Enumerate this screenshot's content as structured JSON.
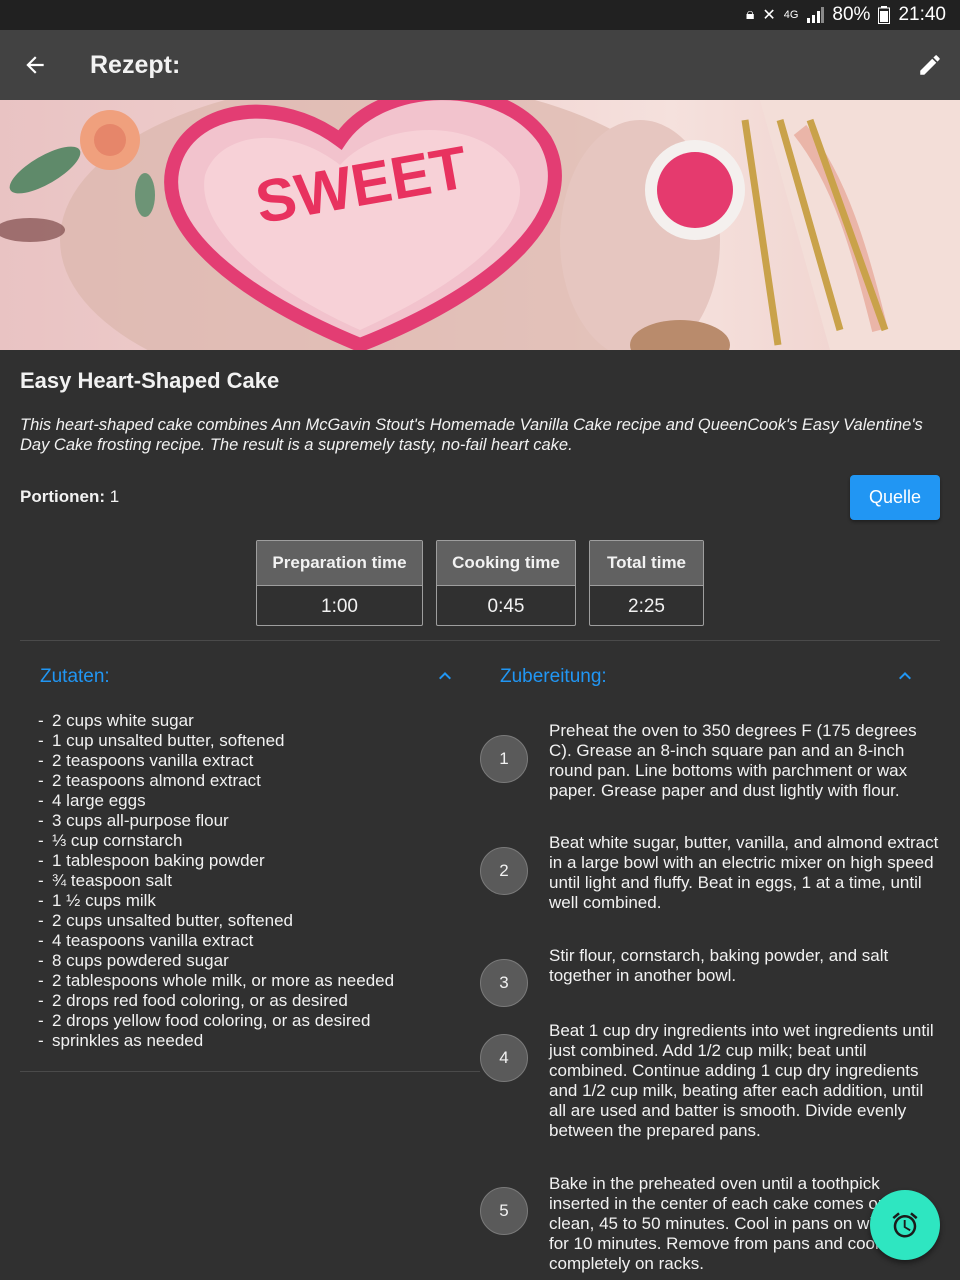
{
  "status_bar": {
    "battery": "80%",
    "time": "21:40",
    "network": "4G"
  },
  "app_bar": {
    "title": "Rezept:",
    "back_icon": "arrow-back-icon",
    "edit_icon": "pencil-icon"
  },
  "hero_image": {
    "text": "SWEET"
  },
  "recipe": {
    "title": "Easy Heart-Shaped Cake",
    "description": "This heart-shaped cake combines Ann McGavin Stout's Homemade Vanilla Cake recipe and QueenCook's Easy Valentine's Day Cake frosting recipe. The result is a supremely tasty, no-fail heart cake.",
    "servings_label": "Portionen:",
    "servings_value": "1",
    "source_button": "Quelle"
  },
  "times": [
    {
      "label": "Preparation time",
      "value": "1:00"
    },
    {
      "label": "Cooking time",
      "value": "0:45"
    },
    {
      "label": "Total time",
      "value": "2:25"
    }
  ],
  "ingredients_section": {
    "title": "Zutaten:",
    "items": [
      "2 cups white sugar",
      "1 cup unsalted butter, softened",
      "2 teaspoons vanilla extract",
      "2 teaspoons almond extract",
      "4 large eggs",
      "3 cups all-purpose flour",
      "⅓ cup cornstarch",
      "1 tablespoon baking powder",
      "¾ teaspoon salt",
      "1 ½ cups milk",
      "2 cups unsalted butter, softened",
      "4 teaspoons vanilla extract",
      "8 cups powdered sugar",
      "2 tablespoons whole milk, or more as needed",
      "2 drops red food coloring, or as desired",
      "2 drops yellow food coloring, or as desired",
      "sprinkles as needed"
    ]
  },
  "preparation_section": {
    "title": "Zubereitung:",
    "steps": [
      {
        "number": "1",
        "text": "Preheat the oven to 350 degrees F (175 degrees C). Grease an 8-inch square pan and an 8-inch round pan. Line bottoms with parchment or wax paper. Grease paper and dust lightly with flour."
      },
      {
        "number": "2",
        "text": "Beat white sugar, butter, vanilla, and almond extract in a large bowl with an electric mixer on high speed until light and fluffy. Beat in eggs, 1 at a time, until well combined."
      },
      {
        "number": "3",
        "text": "Stir flour, cornstarch, baking powder, and salt together in another bowl."
      },
      {
        "number": "4",
        "text": "Beat 1 cup dry ingredients into wet ingredients until just combined. Add 1/2 cup milk; beat until combined. Continue adding 1 cup dry ingredients and 1/2 cup milk, beating after each addition, until all are used and batter is smooth. Divide evenly between the prepared pans."
      },
      {
        "number": "5",
        "text": "Bake in the preheated oven until a toothpick inserted in the center of each cake comes out clean, 45 to 50 minutes. Cool in pans on wire racks for 10 minutes. Remove from pans and cool completely on racks."
      }
    ]
  },
  "fab": {
    "icon": "alarm-clock-icon"
  },
  "colors": {
    "accent": "#2196f3",
    "fab": "#2ee6c1",
    "background": "#303030",
    "appbar": "#424242"
  }
}
